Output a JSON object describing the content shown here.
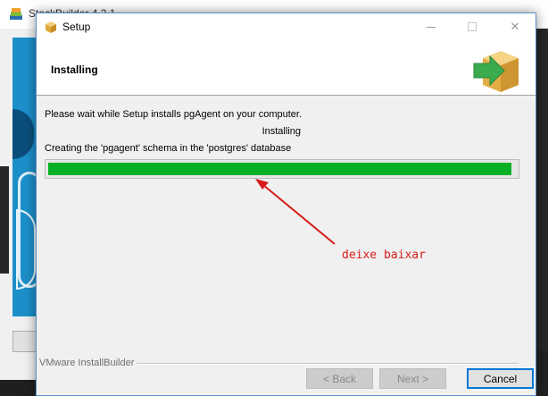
{
  "background_window": {
    "title": "StackBuilder 4.2.1"
  },
  "window": {
    "title": "Setup",
    "controls": {
      "minimize": "",
      "maximize": "",
      "close": "✕"
    }
  },
  "header": {
    "title": "Installing",
    "icon": "install-box-arrow-icon"
  },
  "main": {
    "message": "Please wait while Setup installs pgAgent on your computer.",
    "status": "Installing",
    "detail": "Creating the 'pgagent' schema in the 'postgres' database",
    "progress_percent": 99,
    "progress_color": "#06b025"
  },
  "annotation": {
    "text": "deixe baixar",
    "color": "#d71a1a"
  },
  "footer": {
    "brand": "VMware InstallBuilder",
    "buttons": {
      "back": "< Back",
      "next": "Next >",
      "cancel": "Cancel"
    }
  }
}
